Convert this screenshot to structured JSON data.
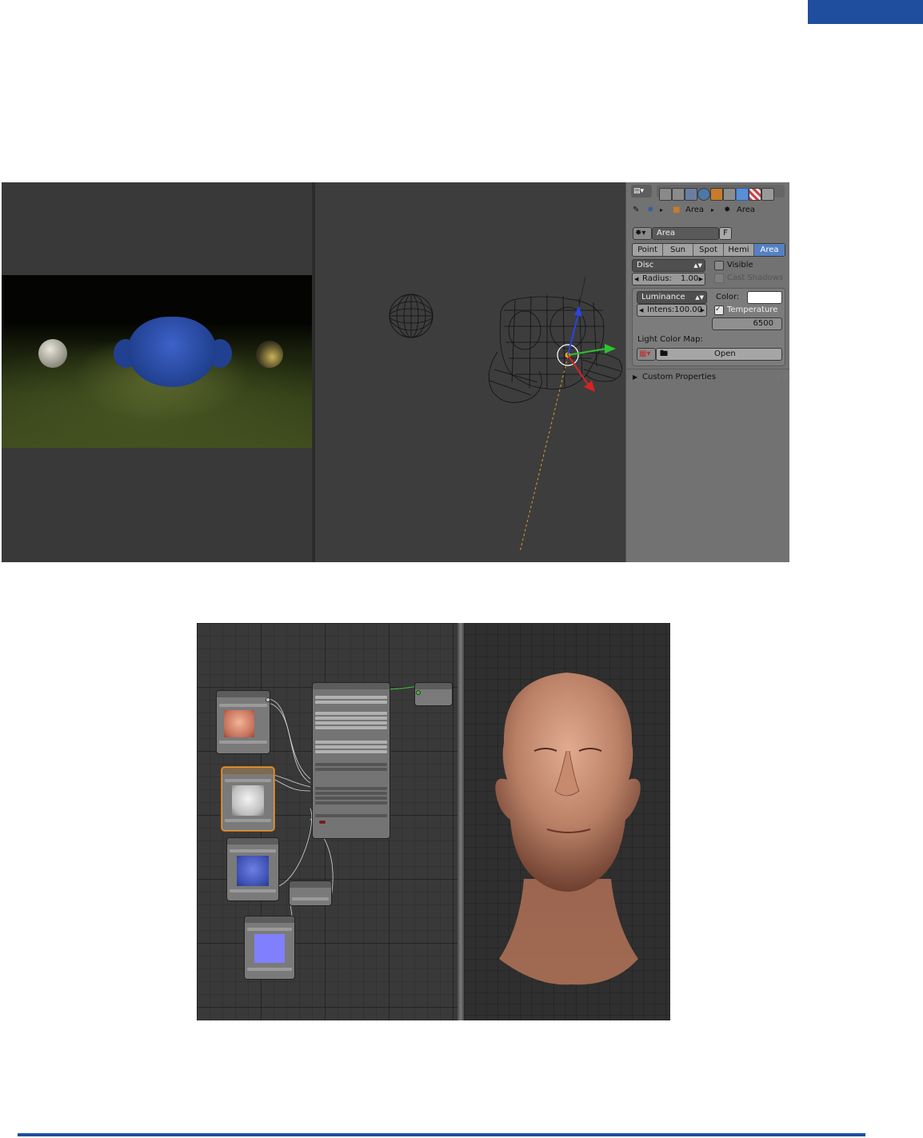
{
  "page": {
    "accent_color": "#1f4e9e"
  },
  "shot1": {
    "properties": {
      "header_icons": [
        "editor-type-icon",
        "render-icon",
        "render-layers-icon",
        "scene-icon",
        "world-icon",
        "object-icon",
        "constraints-icon",
        "data-icon",
        "texture-icon",
        "particles-icon"
      ],
      "breadcrumb": {
        "object": "Area",
        "data": "Area"
      },
      "datablock": {
        "name": "Area",
        "fake_user": "F"
      },
      "light_types": [
        {
          "label": "Point",
          "active": false
        },
        {
          "label": "Sun",
          "active": false
        },
        {
          "label": "Spot",
          "active": false
        },
        {
          "label": "Hemi",
          "active": false
        },
        {
          "label": "Area",
          "active": true
        }
      ],
      "shape": {
        "value": "Disc",
        "radius_label": "Radius:",
        "radius_value": "1.00"
      },
      "visible": {
        "label": "Visible",
        "checked": false
      },
      "cast_shadows": {
        "label": "Cast Shadows",
        "checked": false
      },
      "intensity_mode": "Luminance",
      "intensity": {
        "label": "Intens:",
        "value": "100.00"
      },
      "color": {
        "label": "Color:",
        "value": "#ffffff"
      },
      "temperature": {
        "label": "Temperature",
        "checked": true,
        "value": "6500"
      },
      "color_map": {
        "label": "Light Color Map:",
        "open_label": "Open"
      },
      "custom_properties": "Custom Properties"
    }
  },
  "shot2": {
    "head_skin_color": "#b98066"
  }
}
